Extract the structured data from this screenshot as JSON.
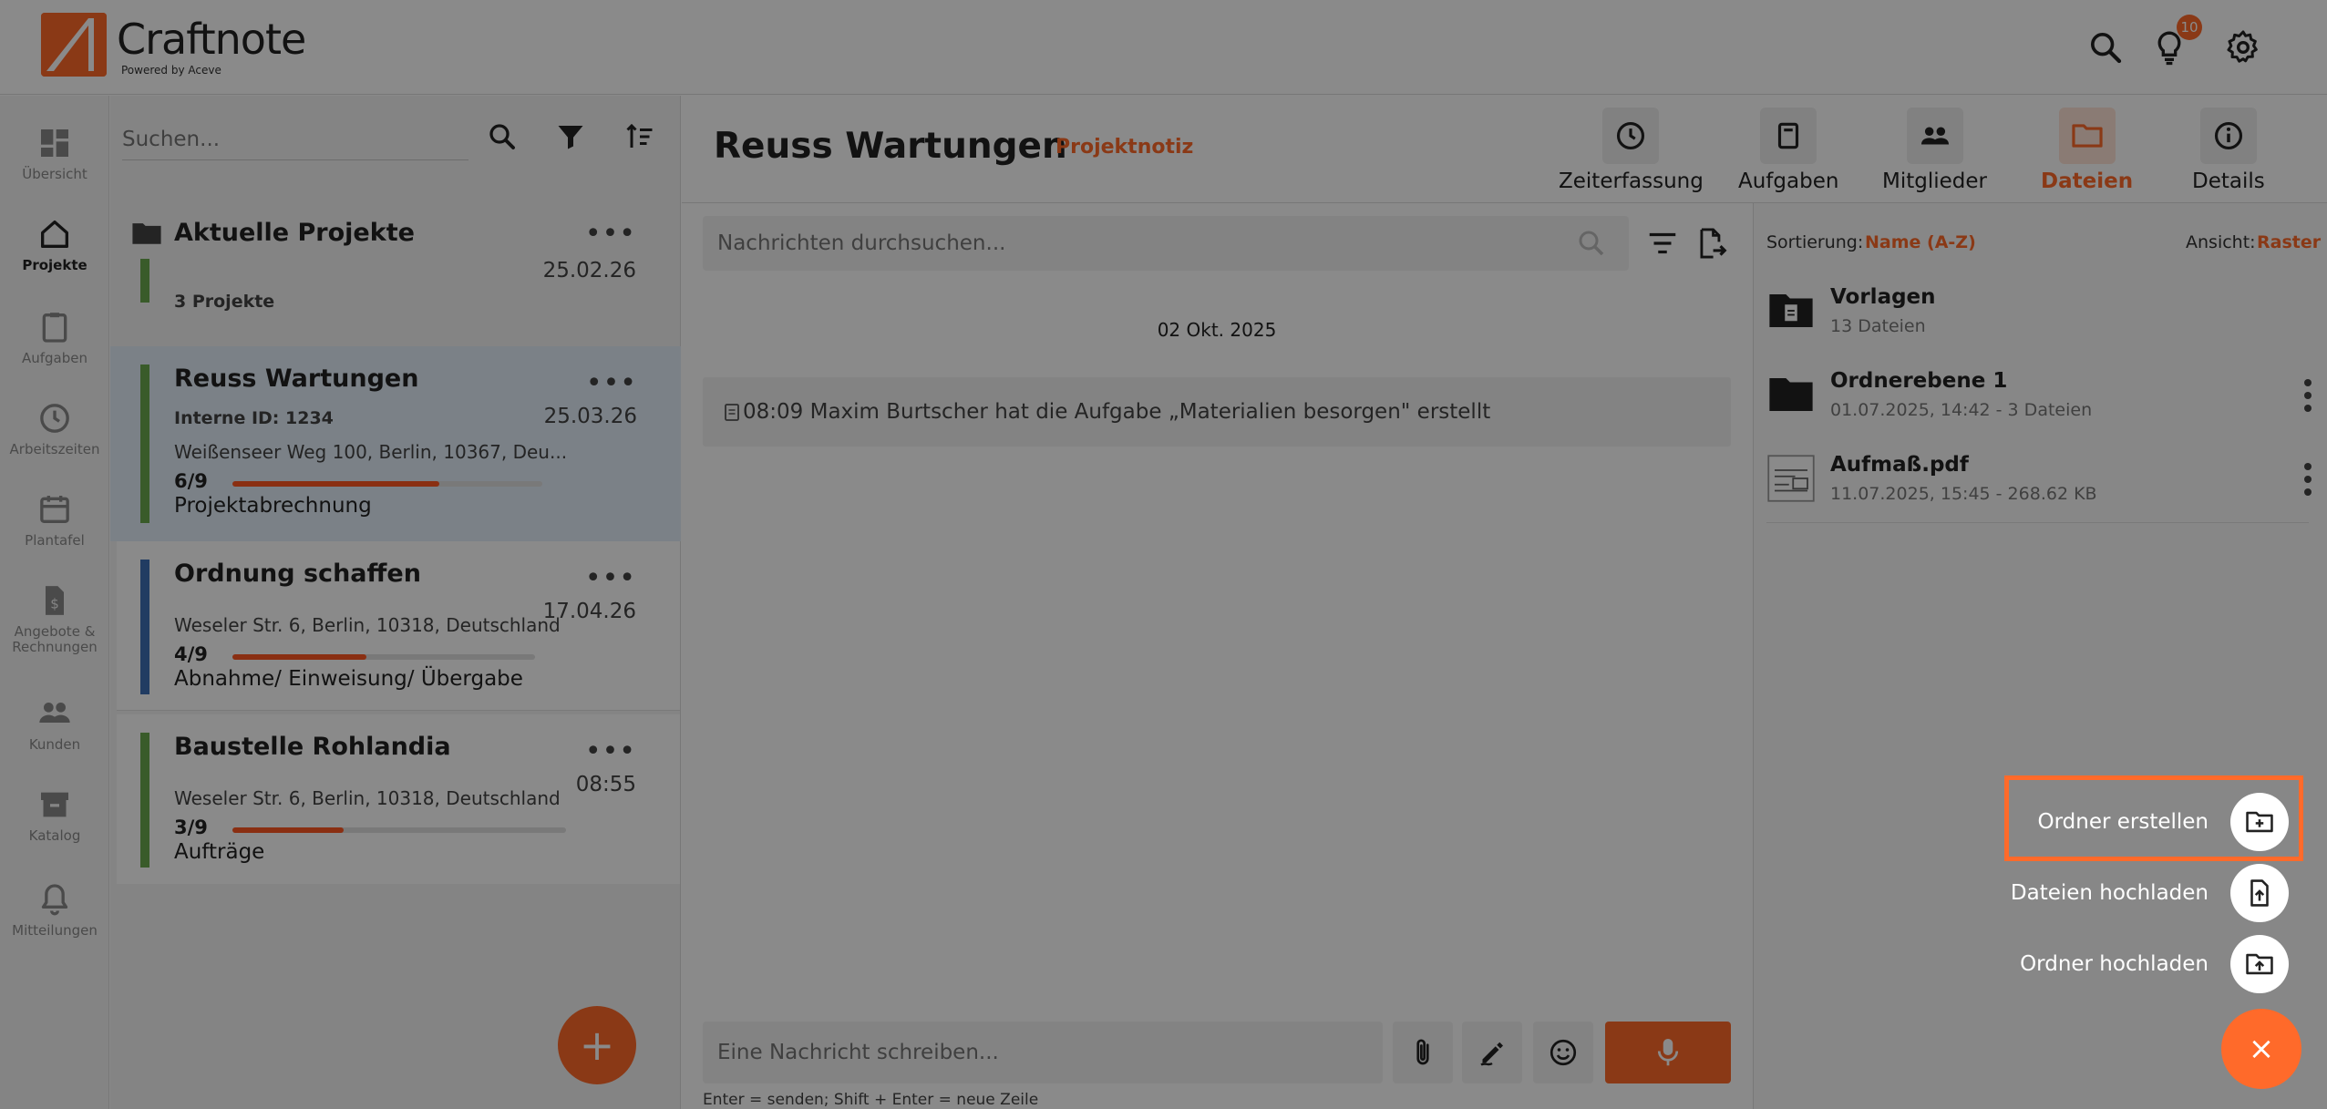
{
  "app": {
    "name": "Craftnote",
    "tagline": "Powered by Aceve",
    "notification_count": "10"
  },
  "colors": {
    "accent": "#ff6a2a",
    "progress_fill": "#ff5722",
    "bar_green": "#6aa84f",
    "bar_blue": "#3d6fb6"
  },
  "nav": {
    "items": [
      {
        "label": "Übersicht",
        "icon": "dashboard-icon"
      },
      {
        "label": "Projekte",
        "icon": "house-icon",
        "active": true
      },
      {
        "label": "Aufgaben",
        "icon": "clipboard-icon"
      },
      {
        "label": "Arbeitszeiten",
        "icon": "clock-icon"
      },
      {
        "label": "Plantafel",
        "icon": "calendar-icon"
      },
      {
        "label": "Angebote & Rechnungen",
        "icon": "invoice-icon"
      },
      {
        "label": "Kunden",
        "icon": "people-icon"
      },
      {
        "label": "Katalog",
        "icon": "archive-box-icon"
      },
      {
        "label": "Mitteilungen",
        "icon": "bell-icon"
      }
    ]
  },
  "projects": {
    "search_placeholder": "Suchen...",
    "folder": {
      "title": "Aktuelle Projekte",
      "date": "25.02.26",
      "count": "3 Projekte"
    },
    "items": [
      {
        "title": "Reuss Wartungen",
        "internal_id": "Interne ID: 1234",
        "date": "25.03.26",
        "address": "Weißenseer Weg 100, Berlin, 10367, Deu...",
        "fraction": "6/9",
        "progress": 0.667,
        "phase": "Projektabrechnung",
        "selected": true
      },
      {
        "title": "Ordnung schaffen",
        "date": "17.04.26",
        "address": "Weseler Str. 6, Berlin, 10318, Deutschland",
        "fraction": "4/9",
        "progress": 0.444,
        "phase": "Abnahme/ Einweisung/ Übergabe"
      },
      {
        "title": "Baustelle Rohlandia",
        "date": "08:55",
        "address": "Weseler Str. 6, Berlin, 10318, Deutschland",
        "fraction": "3/9",
        "progress": 0.333,
        "phase": "Aufträge"
      }
    ],
    "add_label": "+"
  },
  "main": {
    "title": "Reuss Wartungen",
    "note": "Projektnotiz",
    "tabs": [
      {
        "label": "Zeiterfassung",
        "icon": "clock-icon"
      },
      {
        "label": "Aufgaben",
        "icon": "task-icon"
      },
      {
        "label": "Mitglieder",
        "icon": "members-icon"
      },
      {
        "label": "Dateien",
        "icon": "folder-icon",
        "active": true
      },
      {
        "label": "Details",
        "icon": "info-icon"
      }
    ],
    "chat": {
      "search_placeholder": "Nachrichten durchsuchen...",
      "date_label": "02 Okt. 2025",
      "event": "08:09 Maxim Burtscher hat die Aufgabe „Materialien besorgen\" erstellt",
      "composer_placeholder": "Eine Nachricht schreiben...",
      "hint": "Enter = senden; Shift + Enter = neue Zeile"
    }
  },
  "files": {
    "sort_label": "Sortierung:",
    "sort_value": "Name (A-Z)",
    "view_label": "Ansicht:",
    "view_value": "Raster",
    "items": [
      {
        "name": "Vorlagen",
        "meta": "13 Dateien",
        "icon": "template-folder-icon"
      },
      {
        "name": "Ordnerebene 1",
        "meta": "01.07.2025, 14:42 - 3 Dateien",
        "icon": "folder-icon"
      },
      {
        "name": "Aufmaß.pdf",
        "meta": "11.07.2025, 15:45 - 268.62 KB",
        "icon": "pdf-thumbnail-icon"
      }
    ]
  },
  "speed_dial": {
    "items": [
      {
        "label": "Ordner erstellen",
        "icon": "create-folder-icon"
      },
      {
        "label": "Dateien hochladen",
        "icon": "upload-file-icon"
      },
      {
        "label": "Ordner hochladen",
        "icon": "upload-folder-icon"
      }
    ],
    "close_label": "×"
  }
}
